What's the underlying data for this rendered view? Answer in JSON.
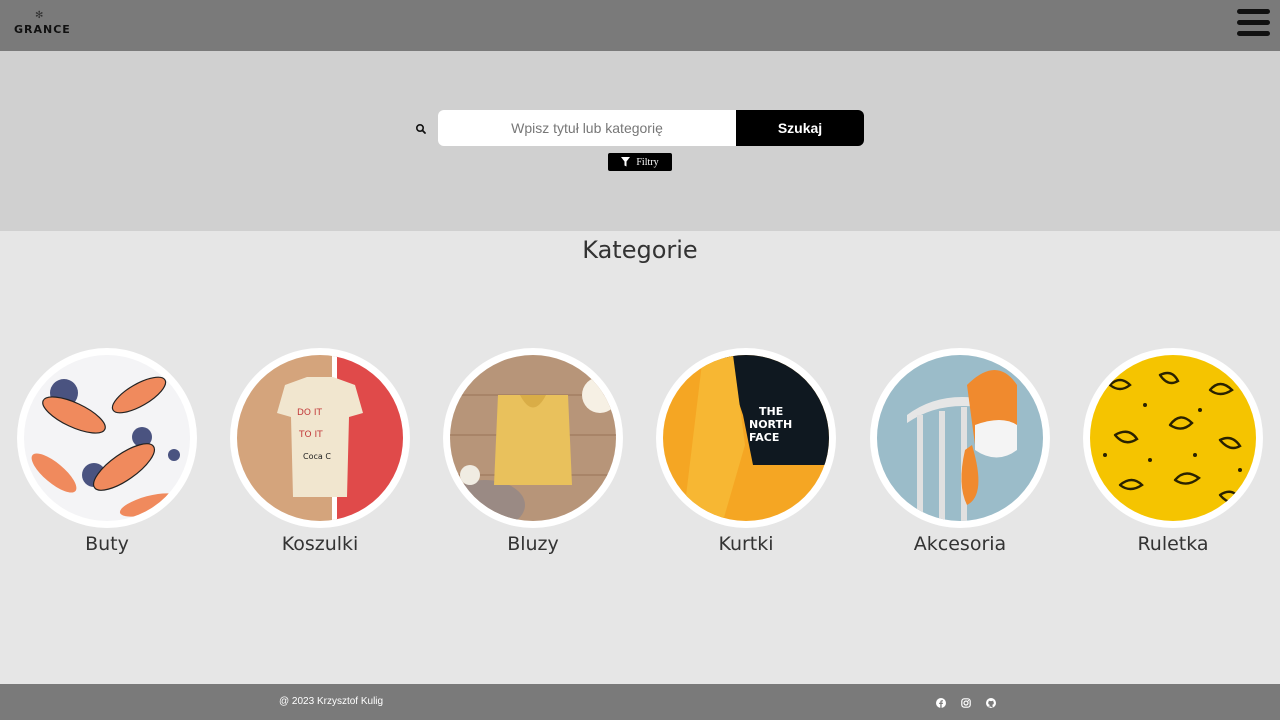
{
  "header": {
    "logo_text": "GRANCE"
  },
  "search": {
    "placeholder": "Wpisz tytuł lub kategorię",
    "button_label": "Szukaj",
    "filter_label": "Filtry"
  },
  "main": {
    "section_title": "Kategorie",
    "categories": [
      {
        "label": "Buty"
      },
      {
        "label": "Koszulki"
      },
      {
        "label": "Bluzy"
      },
      {
        "label": "Kurtki"
      },
      {
        "label": "Akcesoria"
      },
      {
        "label": "Ruletka"
      }
    ]
  },
  "footer": {
    "copyright": "@ 2023 Krzysztof Kulig",
    "social_icons": [
      "facebook-icon",
      "instagram-icon",
      "github-icon"
    ]
  },
  "colors": {
    "topbar": "#7a7a7a",
    "search_band": "#d0d0d0",
    "page_bg": "#e6e6e6",
    "button": "#000000",
    "ruletka_yellow": "#f5c400",
    "jacket_orange": "#f5a623"
  }
}
